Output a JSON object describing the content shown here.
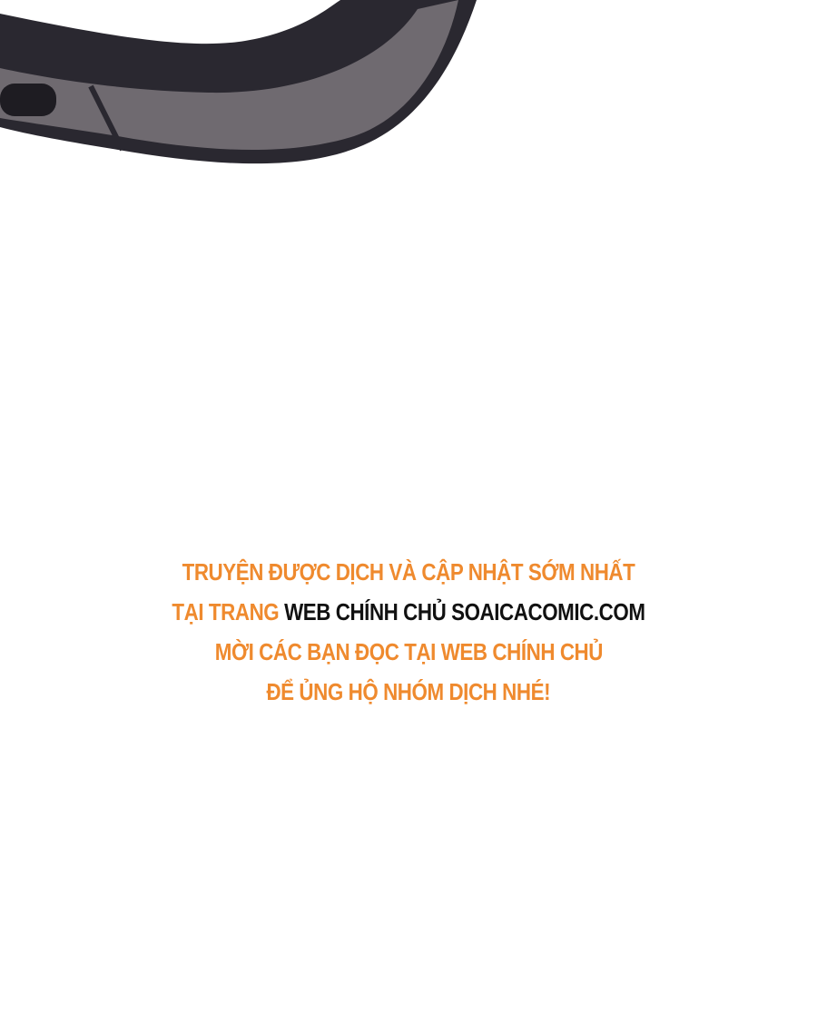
{
  "colors": {
    "orange": "#ef8a2e",
    "black": "#111111",
    "object_dark": "#2a2830",
    "object_light": "#6f6a70"
  },
  "notice": {
    "line1": "TRUYỆN ĐƯỢC DỊCH VÀ CẬP NHẬT SỚM NHẤT",
    "line2_orange": "TẠI TRANG",
    "line2_black": "WEB CHÍNH CHỦ SOAICACOMIC.COM",
    "line3": "MỜI CÁC BẠN ĐỌC TẠI WEB CHÍNH CHỦ",
    "line4": "ĐỂ ỦNG HỘ NHÓM DỊCH NHÉ!"
  }
}
